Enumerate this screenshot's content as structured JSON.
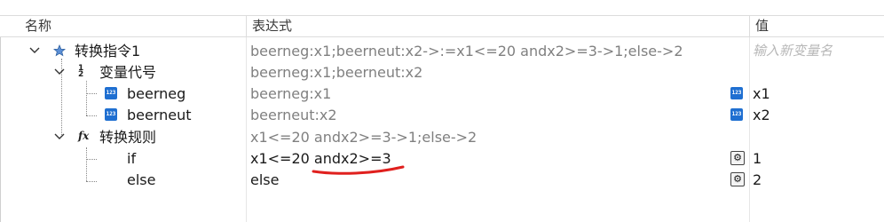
{
  "columns": {
    "name": "名称",
    "expression": "表达式",
    "value": "值"
  },
  "rows": [
    {
      "name": "转换指令1",
      "expression": "beerneg:x1;beerneut:x2->:=x1<=20 andx2>=3->1;else->2",
      "value_placeholder": "输入新变量名"
    },
    {
      "name": "变量代号",
      "expression": "beerneg:x1;beerneut:x2"
    },
    {
      "name": "beerneg",
      "expression": "beerneg:x1",
      "value": "x1"
    },
    {
      "name": "beerneut",
      "expression": "beerneut:x2",
      "value": "x2"
    },
    {
      "name": "转换规则",
      "expression": "x1<=20 andx2>=3->1;else->2"
    },
    {
      "name": "if",
      "expression": "x1<=20 andx2>=3",
      "value": "1"
    },
    {
      "name": "else",
      "expression": "else",
      "value": "2"
    }
  ],
  "icons": {
    "root": "star-icon",
    "varcode": "variable-code-icon",
    "var": "number-variable-icon",
    "rule": "function-icon",
    "gear": "gear-icon"
  },
  "colors": {
    "underline": "#e0201e",
    "var_icon": "#1f6fd1",
    "star": "#5b8fd6"
  }
}
